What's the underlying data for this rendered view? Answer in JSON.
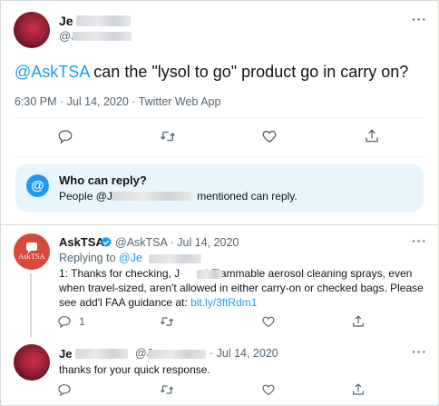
{
  "main_tweet": {
    "author_name": "Je",
    "author_handle": "@J",
    "mention": "@AskTSA",
    "text": " can the \"lysol to go\" product go in carry on?",
    "meta": "6:30 PM · Jul 14, 2020 · Twitter Web App"
  },
  "who_can_reply": {
    "title": "Who can reply?",
    "desc_prefix": "People @J",
    "desc_suffix": " mentioned can reply.",
    "icon": "@"
  },
  "reply1": {
    "author_name": "AskTSA",
    "author_handle": "@AskTSA",
    "date": "· Jul 14, 2020",
    "replying_to_label": "Replying to ",
    "replying_to_handle": "@Je",
    "avatar_text": "AskTSA",
    "line1_a": "1: Thanks for checking, J",
    "line1_b": "! Flammable aerosol cleaning sprays, even",
    "line2": "when travel-sized, aren't allowed in either carry-on or checked bags. Please",
    "line3_a": "see add'l FAA guidance at: ",
    "line3_link": "bit.ly/3ftRdm1",
    "reply_count": "1"
  },
  "reply2": {
    "author_name": "Je",
    "author_handle": "@J",
    "date": "· Jul 14, 2020",
    "text": "thanks for your quick response."
  },
  "colors": {
    "accent": "#1d9bf0",
    "tsa": "#d84a3c"
  },
  "icons": [
    "reply-icon",
    "retweet-icon",
    "like-icon",
    "share-icon",
    "more-icon",
    "verified-icon"
  ]
}
